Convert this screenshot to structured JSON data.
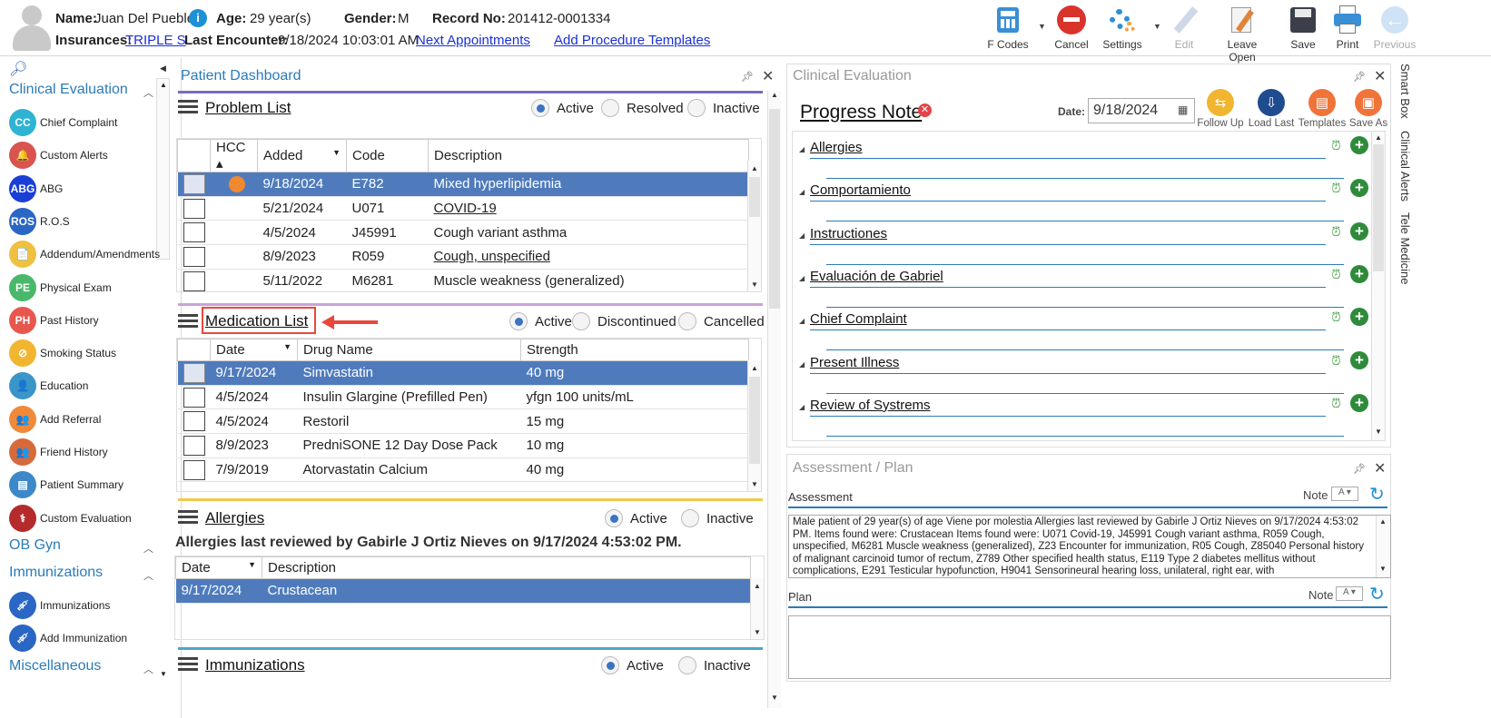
{
  "header": {
    "name_label": "Name:",
    "name": "Juan Del Pueblo",
    "age_label": "Age:",
    "age": "29 year(s)",
    "gender_label": "Gender:",
    "gender": "M",
    "record_label": "Record No:",
    "record": "201412-0001334",
    "insurances_label": "Insurances:",
    "insurance": "TRIPLE S",
    "last_encounter_label": "Last Encounter:",
    "last_encounter": "9/18/2024 10:03:01 AM",
    "next_appointments": "Next Appointments",
    "add_procedure_templates": "Add Procedure Templates"
  },
  "toolbar": {
    "fcodes": "F Codes",
    "cancel": "Cancel",
    "settings": "Settings",
    "edit": "Edit",
    "leave_open": "Leave Open",
    "save": "Save",
    "print": "Print",
    "previous": "Previous"
  },
  "leftnav": {
    "sections": {
      "clinical": "Clinical Evaluation",
      "obgyn": "OB Gyn",
      "immunizations": "Immunizations",
      "misc": "Miscellaneous"
    },
    "items": [
      {
        "label": "Chief Complaint",
        "icon": "cc-icon",
        "text": "CC",
        "color": "#2fb3d3"
      },
      {
        "label": "Custom Alerts",
        "icon": "bell-alert-icon",
        "text": "🔔",
        "color": "#d9534f"
      },
      {
        "label": "ABG",
        "icon": "abg-icon",
        "text": "ABG",
        "color": "#1a3fd6"
      },
      {
        "label": "R.O.S",
        "icon": "ros-icon",
        "text": "ROS",
        "color": "#2a66c4"
      },
      {
        "label": "Addendum/Amendments",
        "icon": "document-icon",
        "text": "📄",
        "color": "#f0c040"
      },
      {
        "label": "Physical Exam",
        "icon": "pe-icon",
        "text": "PE",
        "color": "#49b86a"
      },
      {
        "label": "Past History",
        "icon": "ph-icon",
        "text": "PH",
        "color": "#e8574e"
      },
      {
        "label": "Smoking Status",
        "icon": "no-smoking-icon",
        "text": "⊘",
        "color": "#f2b530"
      },
      {
        "label": "Education",
        "icon": "education-icon",
        "text": "👤",
        "color": "#3a96c8"
      },
      {
        "label": "Add Referral",
        "icon": "referral-icon",
        "text": "👥",
        "color": "#f08a3a"
      },
      {
        "label": "Friend History",
        "icon": "friends-icon",
        "text": "👥",
        "color": "#d66a3a"
      },
      {
        "label": "Patient Summary",
        "icon": "summary-icon",
        "text": "▤",
        "color": "#3d88c9"
      },
      {
        "label": "Custom Evaluation",
        "icon": "stethoscope-icon",
        "text": "⚕",
        "color": "#b52b2b"
      }
    ],
    "imm_items": [
      {
        "label": "Immunizations",
        "icon": "syringe-icon"
      },
      {
        "label": "Add Immunization",
        "icon": "syringe-add-icon"
      }
    ]
  },
  "dashboard": {
    "title": "Patient Dashboard",
    "problem": {
      "title": "Problem List",
      "radios": [
        "Active",
        "Resolved",
        "Inactive"
      ],
      "columns": [
        "HCC",
        "Added",
        "Code",
        "Description"
      ],
      "rows": [
        {
          "added": "9/18/2024",
          "code": "E782",
          "desc": "Mixed hyperlipidemia",
          "hcc": true
        },
        {
          "added": "5/21/2024",
          "code": "U071",
          "desc": "COVID-19",
          "hcc": false
        },
        {
          "added": "4/5/2024",
          "code": "J45991",
          "desc": "Cough variant asthma",
          "hcc": false
        },
        {
          "added": "8/9/2023",
          "code": "R059",
          "desc": "Cough, unspecified",
          "hcc": false
        },
        {
          "added": "5/11/2022",
          "code": "M6281",
          "desc": "Muscle weakness (generalized)",
          "hcc": false
        }
      ]
    },
    "medication": {
      "title": "Medication List",
      "radios": [
        "Active",
        "Discontinued",
        "Cancelled"
      ],
      "columns": [
        "Date",
        "Drug Name",
        "Strength"
      ],
      "rows": [
        {
          "date": "9/17/2024",
          "drug": "Simvastatin",
          "strength": "40 mg"
        },
        {
          "date": "4/5/2024",
          "drug": "Insulin Glargine (Prefilled Pen)",
          "strength": "yfgn 100 units/mL"
        },
        {
          "date": "4/5/2024",
          "drug": "Restoril",
          "strength": "15 mg"
        },
        {
          "date": "8/9/2023",
          "drug": "PredniSONE 12 Day Dose Pack",
          "strength": "10 mg"
        },
        {
          "date": "7/9/2019",
          "drug": "Atorvastatin Calcium",
          "strength": "40 mg"
        }
      ]
    },
    "allergies": {
      "title": "Allergies",
      "radios": [
        "Active",
        "Inactive"
      ],
      "note": "Allergies last reviewed by Gabirle J Ortiz Nieves on 9/17/2024 4:53:02 PM.",
      "columns": [
        "Date",
        "Description"
      ],
      "rows": [
        {
          "date": "9/17/2024",
          "desc": "Crustacean"
        }
      ]
    },
    "immunizations": {
      "title": "Immunizations",
      "radios": [
        "Active",
        "Inactive"
      ]
    }
  },
  "clinical_eval": {
    "title": "Clinical Evaluation",
    "note_title": "Progress Note",
    "date_label": "Date:",
    "date": "9/18/2024",
    "tools": [
      "Follow Up",
      "Load Last",
      "Templates",
      "Save As"
    ],
    "sections": [
      "Allergies",
      "Comportamiento",
      "Instructiones",
      "Evaluación de Gabriel",
      "Chief Complaint",
      "Present Illness",
      "Review of Systrems"
    ]
  },
  "assessment": {
    "title": "Assessment / Plan",
    "assessment_label": "Assessment",
    "note_label": "Note",
    "assessment_text": "Male patient of 29 year(s) of age Viene por molestia     Allergies last reviewed by Gabirle J Ortiz Nieves on 9/17/2024 4:53:02 PM.    Items found were:  Crustacean  Items found were:  U071 Covid-19, J45991 Cough variant asthma, R059 Cough, unspecified, M6281 Muscle weakness (generalized), Z23 Encounter for immunization, R05 Cough, Z85040 Personal history of malignant carcinoid tumor of rectum, Z789 Other specified health status, E119 Type 2 diabetes mellitus without complications, E291 Testicular hypofunction, H9041 Sensorineural hearing loss, unilateral, right ear, with",
    "plan_label": "Plan",
    "plan_text": ""
  },
  "side_tabs": [
    "Smart Box",
    "Clinical Alerts",
    "Tele Medicine"
  ],
  "colors": {
    "accent": "#2a7bb8",
    "selection": "#4f7bbd",
    "annotation_red": "#e8483b"
  }
}
